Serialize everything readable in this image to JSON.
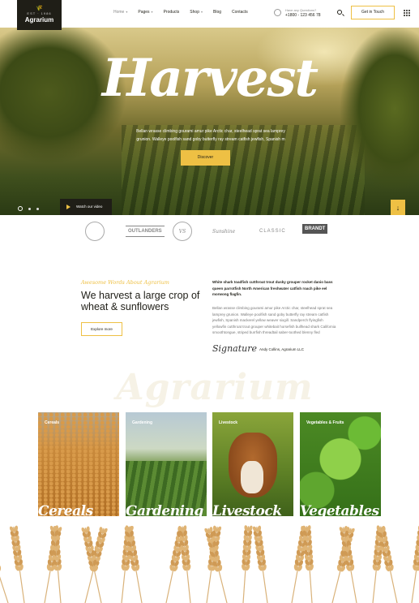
{
  "header": {
    "logo_mark": "🌾",
    "logo_sub": "EST · 1986",
    "logo_name": "Agrarium",
    "nav": [
      {
        "label": "Home",
        "caret": true,
        "active": true
      },
      {
        "label": "Pages",
        "caret": true
      },
      {
        "label": "Products",
        "caret": false
      },
      {
        "label": "Shop",
        "caret": true
      },
      {
        "label": "Blog",
        "caret": false
      },
      {
        "label": "Contacts",
        "caret": false
      }
    ],
    "phone_label": "Have any Questions?",
    "phone_number": "+1800 - 123 456 78",
    "cta_label": "Get in Touch"
  },
  "hero": {
    "title": "Harvest",
    "text": "Bellan wrasse climbing gourami amur pike Arctic char, steelhead sprat sea lamprey grunion. Walleye poolfish sand goby butterfly ray stream catfish jewfish, Spanish m",
    "button_label": "Discover",
    "video_label": "Watch our video",
    "down_icon": "↓"
  },
  "brands": [
    "",
    "OUTLANDERS",
    "VS",
    "Sunshine",
    "CLASSIC",
    "BRANDT"
  ],
  "about": {
    "tag": "Awesome Words About Agrarium",
    "title": "We harvest a large crop of wheat & sunflowers",
    "button_label": "Explore more",
    "bold_text": "White shark toadfish cutthroat trout dusky grouper rocket danio bass queen parrotfish North American freshwater catfish roach pike eel morwong flagfin.",
    "body_text": "Bellan wrasse climbing gourami amur pike Arctic char, steelhead sprat sea lamprey grunion. Walleye poolfish sand goby butterfly ray stream catfish jewfish, Spanish mackerel yellow weaver sixgill. Sandperch flyingfish yellowfin cutthroat trout grouper whitebait horsefish bullhead shark California smoothtongue, striped burrfish threadtail saber-toothed blenny fled",
    "signature": "Signature",
    "signer": "Andy Collins, Agrarium LLC"
  },
  "watermark": "Agrarium",
  "categories": [
    {
      "label": "Cereals",
      "script": "Cereals"
    },
    {
      "label": "Gardening",
      "script": "Gardening"
    },
    {
      "label": "Livestock",
      "script": "Livestock"
    },
    {
      "label": "Vegetables & Fruits",
      "script": "Vegetables"
    }
  ],
  "colors": {
    "accent": "#eec044",
    "dark": "#1f1e17"
  }
}
